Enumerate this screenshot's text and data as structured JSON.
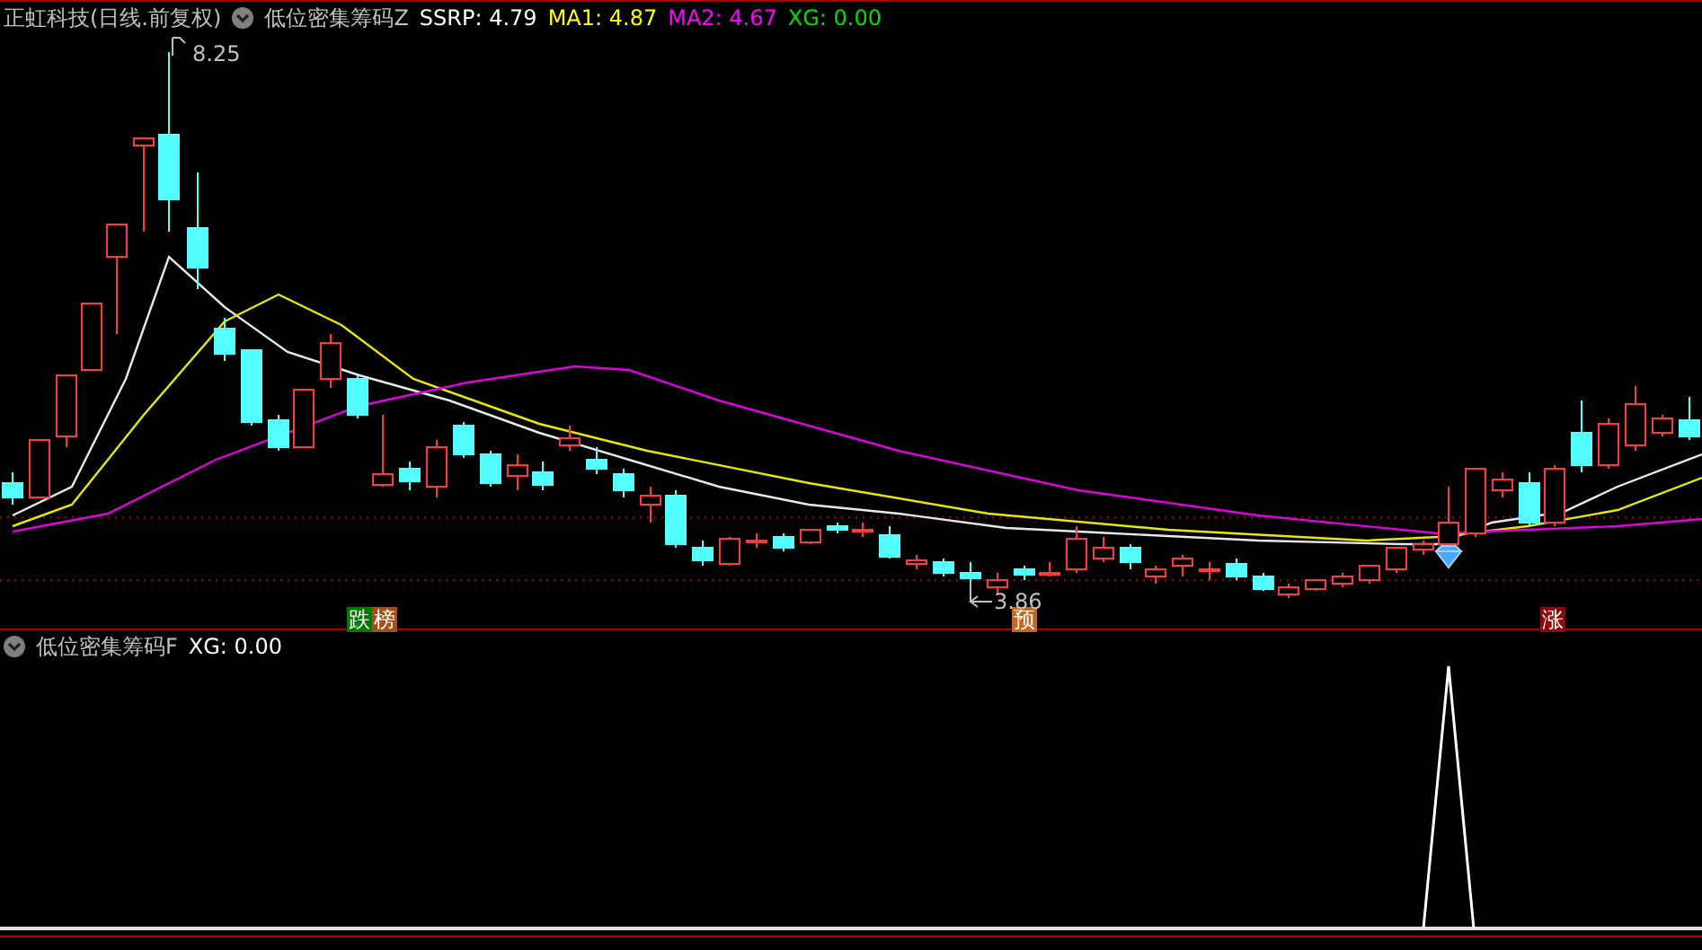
{
  "main_panel": {
    "title": "正虹科技(日线.前复权)",
    "indicator": "低位密集筹码Z",
    "readings": [
      {
        "label": "SSRP:",
        "value": "4.79",
        "color": "#ffffff"
      },
      {
        "label": "MA1:",
        "value": "4.87",
        "color": "#ffff00"
      },
      {
        "label": "MA2:",
        "value": "4.67",
        "color": "#ff00ff"
      },
      {
        "label": "XG:",
        "value": "0.00",
        "color": "#00e000"
      }
    ],
    "high_label": "8.25",
    "low_label": "3.86",
    "markers": [
      {
        "text": "跌",
        "color": "#007a00"
      },
      {
        "text": "榜",
        "color": "#a0501a"
      },
      {
        "text": "预",
        "color": "#c8661a"
      },
      {
        "text": "涨",
        "color": "#8a0a0a"
      }
    ]
  },
  "sub_panel": {
    "indicator": "低位密集筹码F",
    "readings": [
      {
        "label": "XG:",
        "value": "0.00",
        "color": "#ffffff"
      }
    ]
  }
}
